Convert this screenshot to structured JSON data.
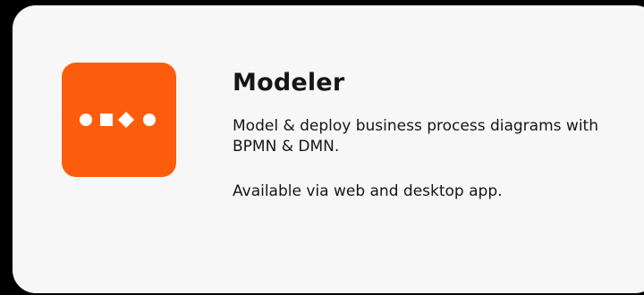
{
  "card": {
    "title": "Modeler",
    "description": "Model & deploy business process diagrams with BPMN & DMN.",
    "availability": "Available via web and desktop app.",
    "logo_icon": "bpmn-shapes-icon",
    "colors": {
      "background": "#000000",
      "card": "#f7f7f7",
      "brand": "#fc5d0d",
      "text": "#161616",
      "icon": "#ffffff"
    }
  }
}
